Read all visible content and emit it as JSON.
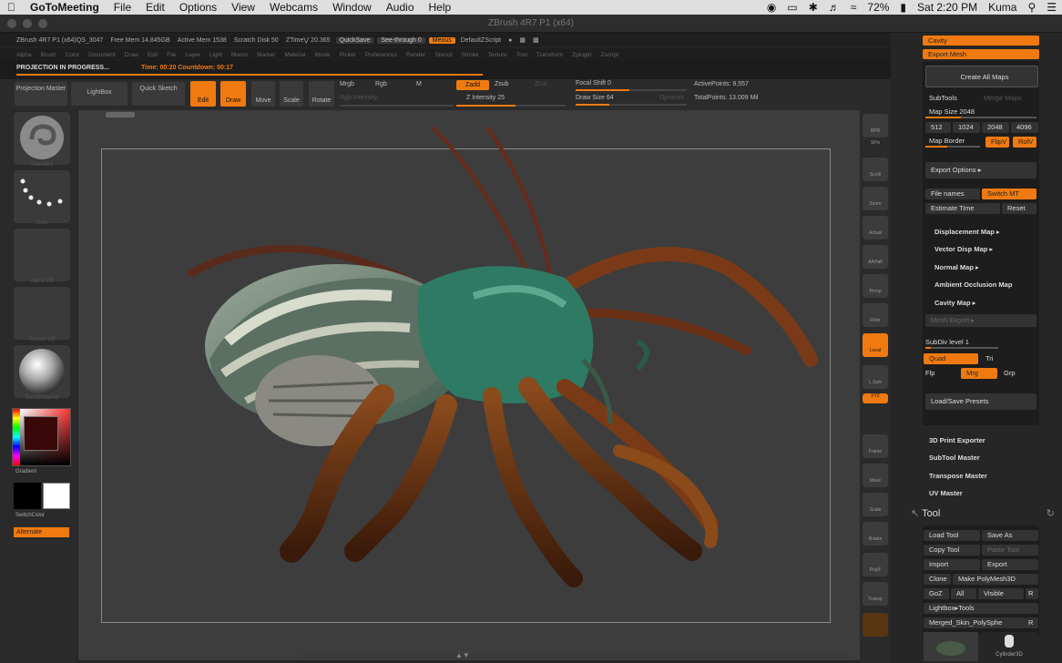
{
  "mac": {
    "app": "GoToMeeting",
    "menus": [
      "File",
      "Edit",
      "Options",
      "View",
      "Webcams",
      "Window",
      "Audio",
      "Help"
    ],
    "battery": "72%",
    "clock": "Sat 2:20 PM",
    "user": "Kuma"
  },
  "window": {
    "title": "ZBrush 4R7 P1 (x64)"
  },
  "zinfo": {
    "app_ver": "ZBrush 4R7 P1 (x64)QS_3047",
    "free_mem": "Free Mem 14.845GB",
    "active_mem": "Active Mem 1538",
    "scratch": "Scratch Disk 50",
    "ztimes": "ZTime⋁ 20.365",
    "quicksave": "QuickSave",
    "see_through": "See-through 0",
    "menus": "Menus",
    "default_script": "DefaultZScript"
  },
  "zmenu": [
    "Alpha",
    "Brush",
    "Color",
    "Document",
    "Draw",
    "Edit",
    "File",
    "Layer",
    "Light",
    "Macro",
    "Marker",
    "Material",
    "Movie",
    "Picker",
    "Preferences",
    "Render",
    "Stencil",
    "Stroke",
    "Texture",
    "Tool",
    "Transform",
    "Zplugin",
    "Zscript"
  ],
  "progress": {
    "label": "PROJECTION IN PROGRESS...",
    "time": "Time: 00:20  Countdown: 00:17"
  },
  "toolbar": {
    "projection_master": "Projection Master",
    "lightbox": "LightBox",
    "quick_sketch": "Quick Sketch",
    "edit": "Edit",
    "draw": "Draw",
    "move": "Move",
    "scale": "Scale",
    "rotate": "Rotate",
    "mrgb": "Mrgb",
    "rgb": "Rgb",
    "m": "M",
    "rgb_intensity": "Rgb Intensity",
    "zadd": "Zadd",
    "zsub": "Zsub",
    "zcut": "Zcut",
    "z_intensity": "Z Intensity 25",
    "focal_shift": "Focal Shift 0",
    "draw_size": "Draw Size 64",
    "dynamic": "Dynamic",
    "active_points": "ActivePoints: 9,557",
    "total_points": "TotalPoints: 13.009 Mil"
  },
  "left": {
    "brush": "Standard",
    "stroke": "Dots",
    "alpha": "Alpha Off",
    "texture": "Texture Off",
    "material": "BasicMaterial",
    "gradient": "Gradient",
    "switch_color": "SwitchColor",
    "alternate": "Alternate"
  },
  "shelf": [
    "BPR",
    "SPix",
    "Scroll",
    "Zoom",
    "Actual",
    "AAHalf",
    "Persp",
    "Floor",
    "Local",
    "L.Sym",
    "XYZ",
    "Frame",
    "Move",
    "Scale",
    "Rotate",
    "PolyF",
    "Transp"
  ],
  "panel": {
    "cavity": "Cavity",
    "export_mesh": "Export Mesh",
    "create_all_maps": "Create All Maps",
    "subtools": "SubTools",
    "merge_maps": "Merge Maps",
    "map_size": "Map Size 2048",
    "sizes": [
      "512",
      "1024",
      "2048",
      "4096"
    ],
    "map_border": "Map Border",
    "flipv": "FlipV",
    "rolluv": "RolV",
    "export_options": "Export Options ▸",
    "file_names": "File names",
    "switch_mt": "Switch MT",
    "estimate_time": "Estimate Time",
    "reset": "Reset",
    "maps": [
      "Displacement Map ▸",
      "Vector Disp Map ▸",
      "Normal Map ▸",
      "Ambient Occlusion Map",
      "Cavity Map ▸"
    ],
    "mesh_export": "Mesh Export ▸",
    "subdiv": "SubDiv level 1",
    "quad": "Quad",
    "tri": "Tri",
    "flp": "Flp",
    "mrg": "Mrg",
    "grp": "Grp",
    "presets": "Load/Save Presets",
    "plugins": [
      "3D Print Exporter",
      "SubTool Master",
      "Transpose Master",
      "UV Master"
    ],
    "tool_title": "Tool",
    "tool_buttons": [
      [
        "Load Tool",
        "Save As"
      ],
      [
        "Copy Tool",
        "Paste Tool"
      ],
      [
        "Import",
        "Export"
      ]
    ],
    "clone": "Clone",
    "make_polymesh": "Make PolyMesh3D",
    "goz": "GoZ",
    "all": "All",
    "visible": "Visible",
    "r": "R",
    "lightbox_tools": "Lightbox▸Tools",
    "merged": "Merged_Skin_PolySphe",
    "r2": "R",
    "cylinder": "Cylinder3D"
  },
  "colors": {
    "accent": "#f07a10",
    "bg": "#262626",
    "viewport": "#3d3d3d"
  }
}
